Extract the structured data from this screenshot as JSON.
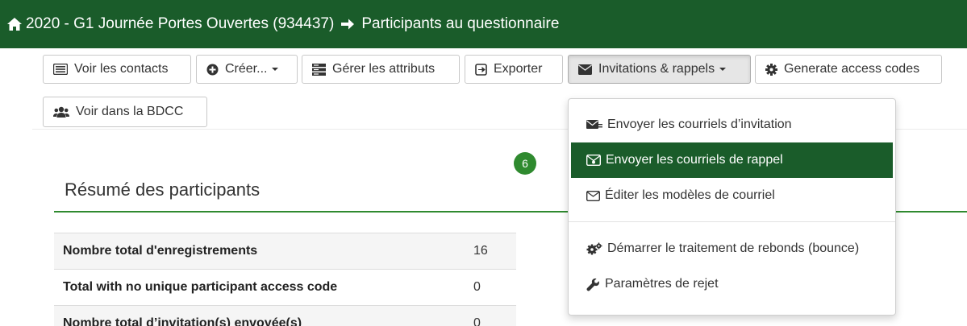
{
  "header": {
    "survey_title": "2020 - G1 Journée Portes Ouvertes (934437)",
    "page_title": "Participants au questionnaire"
  },
  "toolbar": {
    "view_contacts": "Voir les contacts",
    "create": "Créer...",
    "manage_attributes": "Gérer les attributs",
    "export": "Exporter",
    "invitations": "Invitations & rappels",
    "generate_codes": "Generate access codes",
    "view_bdcc": "Voir dans la BDCC"
  },
  "badge": {
    "count": "6"
  },
  "summary": {
    "title": "Résumé des participants",
    "rows": [
      {
        "label": "Nombre total d'enregistrements",
        "value": "16"
      },
      {
        "label": "Total with no unique participant access code",
        "value": "0"
      },
      {
        "label": "Nombre total d’invitation(s) envoyée(s)",
        "value": "0"
      }
    ]
  },
  "invitations_menu": {
    "items": [
      {
        "label": "Envoyer les courriels d’invitation",
        "icon": "envelope-send-icon"
      },
      {
        "label": "Envoyer les courriels de rappel",
        "icon": "envelope-reminder-icon",
        "selected": true
      },
      {
        "label": "Éditer les modèles de courriel",
        "icon": "envelope-outline-icon"
      },
      {
        "label": "Démarrer le traitement de rebonds (bounce)",
        "icon": "gears-icon"
      },
      {
        "label": "Paramètres de rejet",
        "icon": "wrench-icon"
      }
    ]
  },
  "colors": {
    "brand_green": "#1a5c2a",
    "accent_green": "#2f8a2f"
  }
}
